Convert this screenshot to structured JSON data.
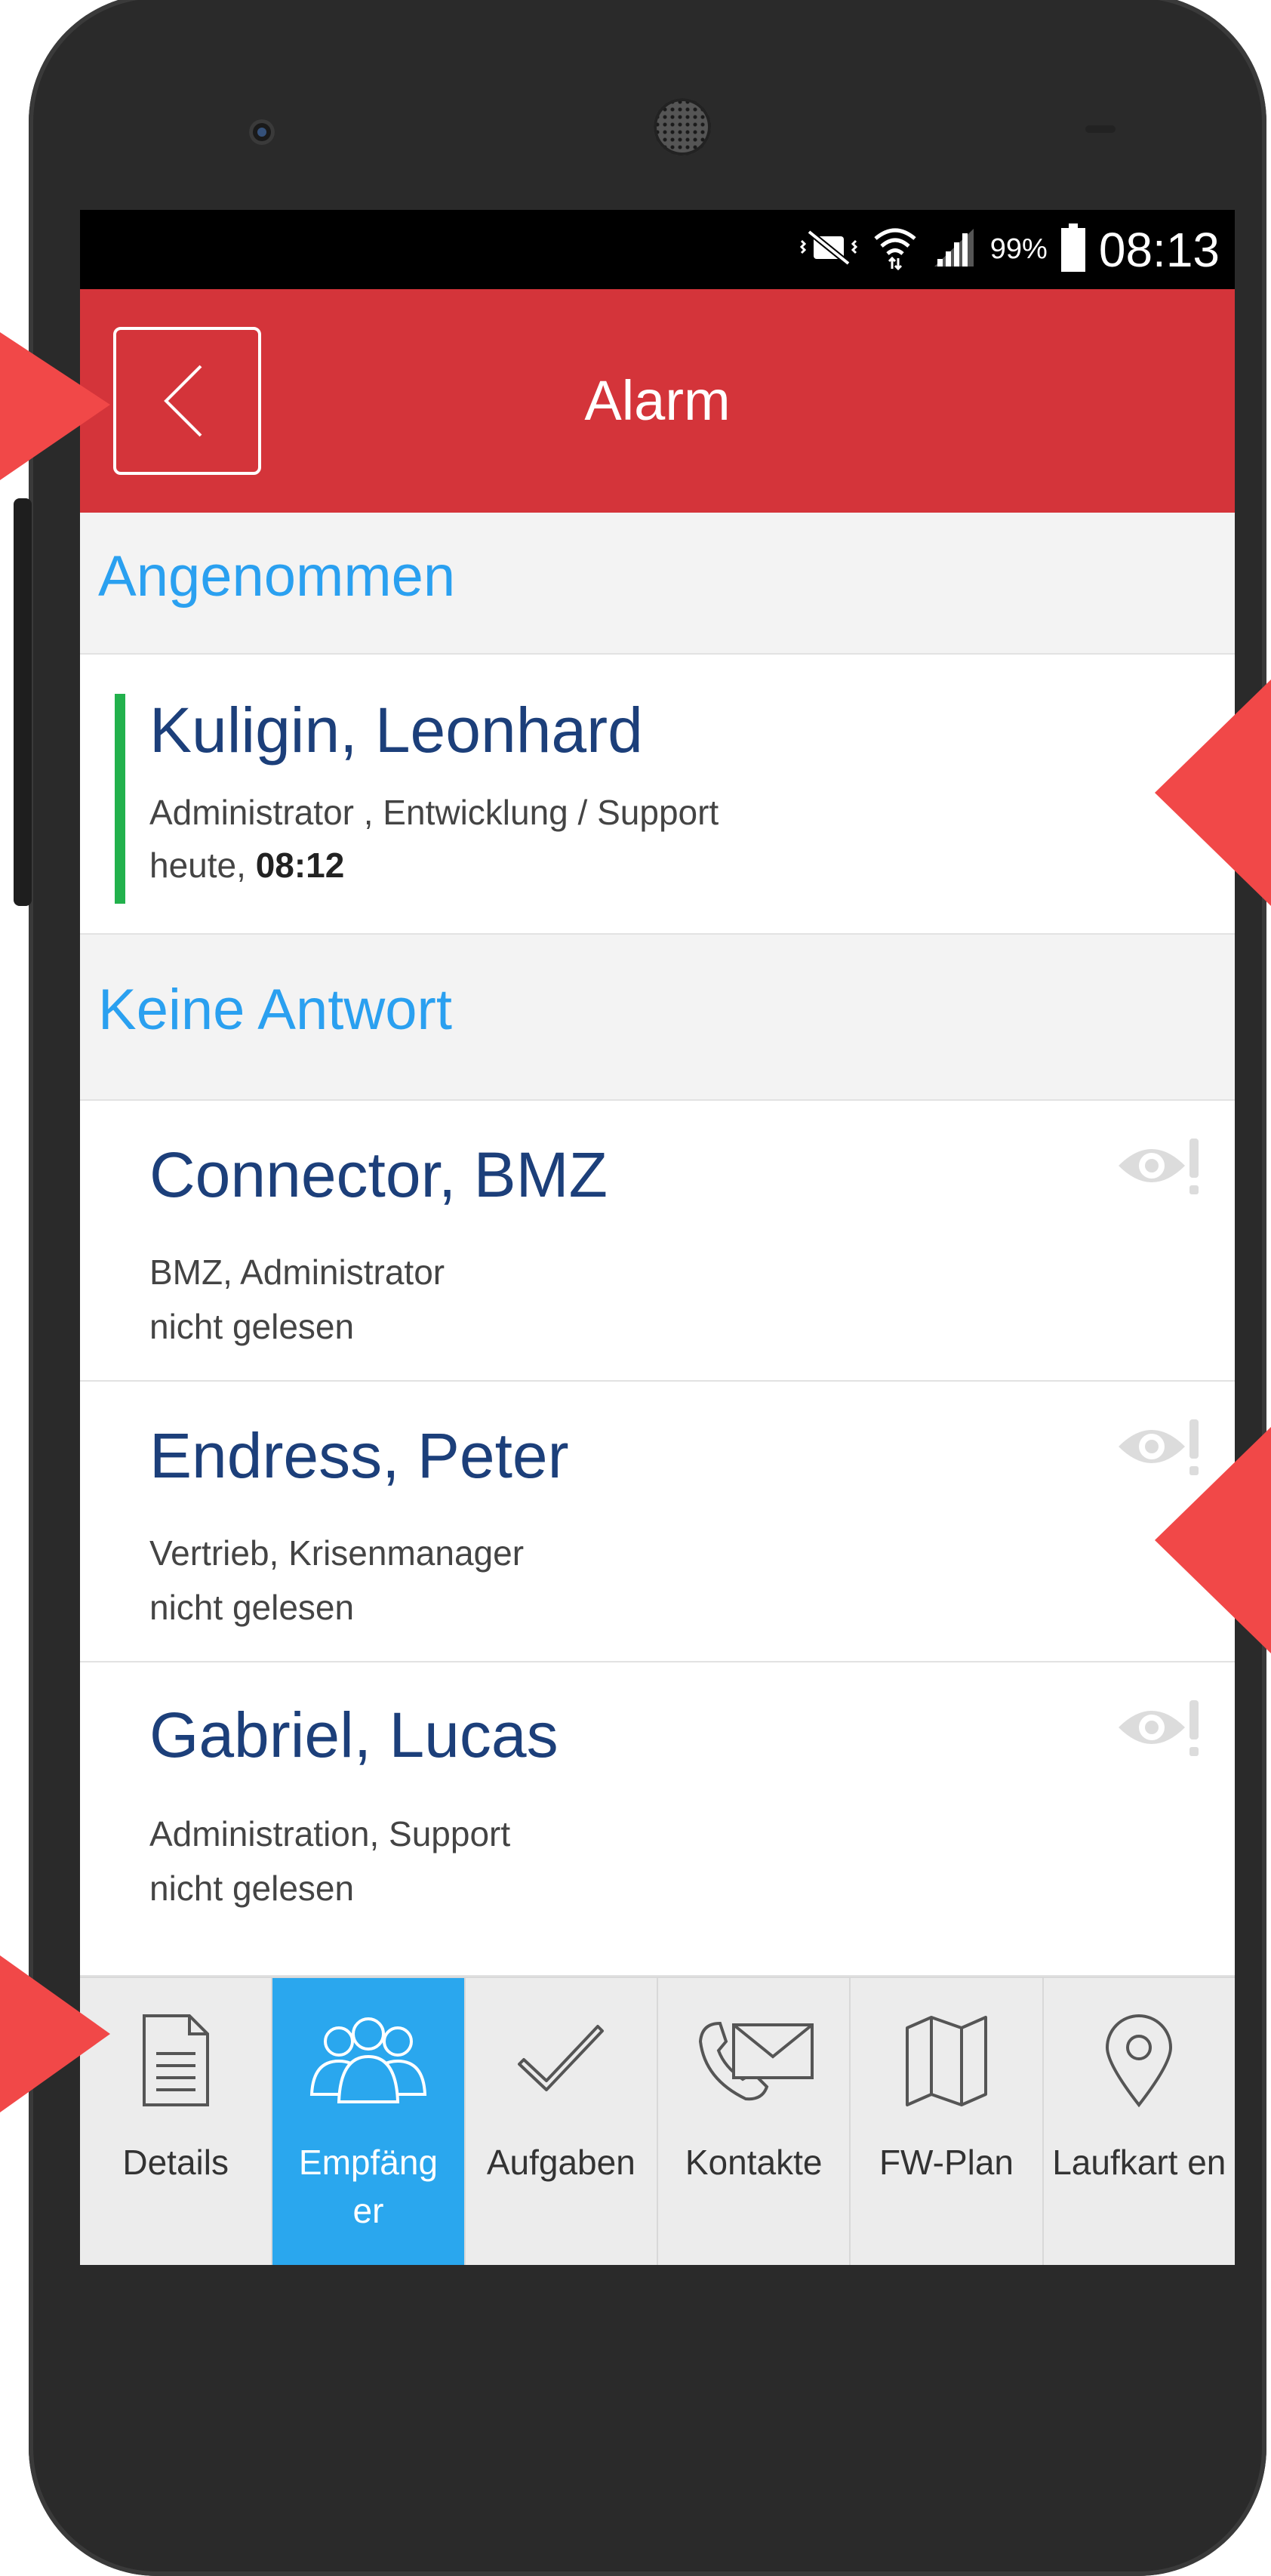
{
  "status_bar": {
    "battery": "99%",
    "time": "08:13"
  },
  "app_bar": {
    "title": "Alarm"
  },
  "sections": [
    {
      "title": "Angenommen",
      "items": [
        {
          "name": "Kuligin, Leonhard",
          "roles": "Administrator , Entwicklung / Support",
          "time_prefix": "heute, ",
          "time": "08:12"
        }
      ]
    },
    {
      "title": "Keine Antwort",
      "items": [
        {
          "name": "Connector, BMZ",
          "roles": "BMZ, Administrator",
          "status": "nicht gelesen"
        },
        {
          "name": "Endress, Peter",
          "roles": "Vertrieb, Krisenmanager",
          "status": "nicht gelesen"
        },
        {
          "name": "Gabriel, Lucas",
          "roles": "Administration, Support",
          "status": "nicht gelesen"
        }
      ]
    }
  ],
  "tabs": [
    {
      "label": "Details",
      "icon": "document-icon"
    },
    {
      "label": "Empfäng er",
      "icon": "people-icon",
      "active": true
    },
    {
      "label": "Aufgaben",
      "icon": "check-icon"
    },
    {
      "label": "Kontakte",
      "icon": "contact-icon"
    },
    {
      "label": "FW-Plan",
      "icon": "map-icon"
    },
    {
      "label": "Laufkart en",
      "icon": "pin-icon"
    }
  ],
  "colors": {
    "appbar": "#d4343a",
    "accent": "#2aa7ee",
    "accepted": "#22b14c",
    "name": "#1c3f7a",
    "arrow": "#f14848"
  }
}
